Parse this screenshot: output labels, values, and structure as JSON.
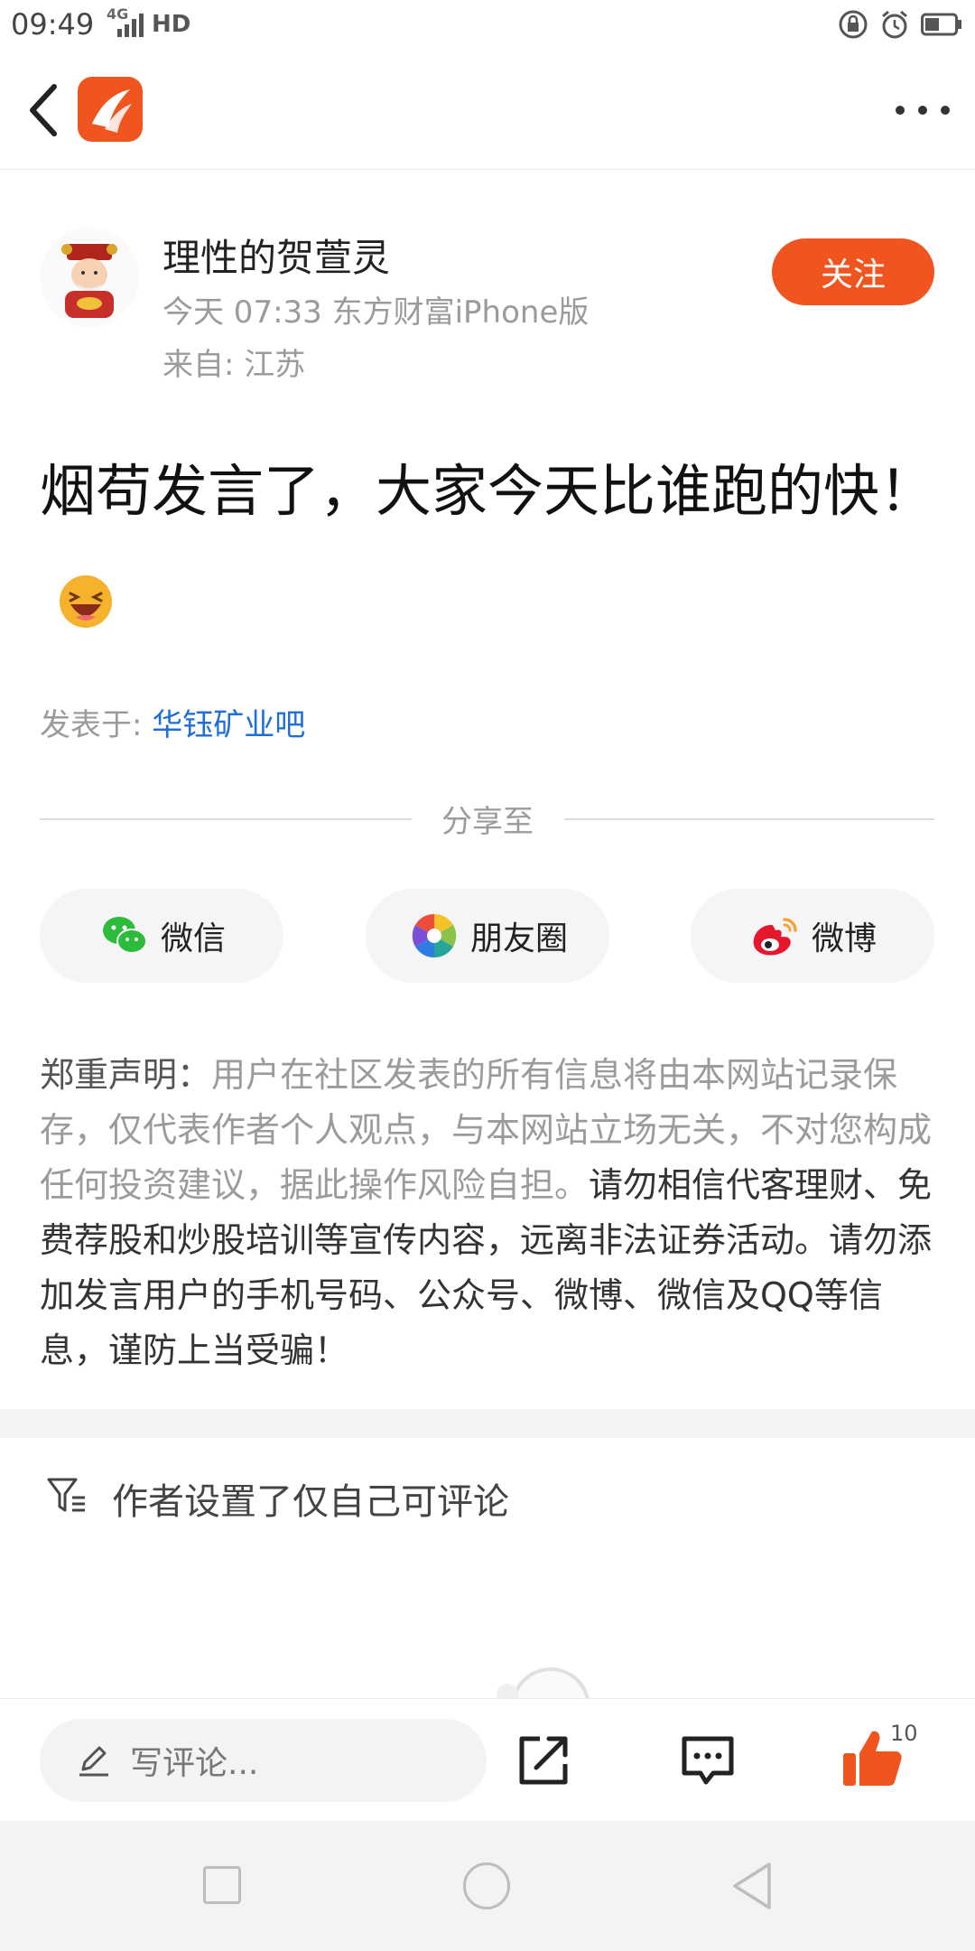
{
  "status_bar": {
    "time": "09:49",
    "network": "4G",
    "hd": "HD"
  },
  "header": {
    "icons": [
      "back-arrow-icon",
      "app-logo",
      "more-icon"
    ]
  },
  "author": {
    "name": "理性的贺萱灵",
    "meta": "今天 07:33 东方财富iPhone版",
    "location": "来自: 江苏",
    "follow_label": "关注"
  },
  "post": {
    "title": "烟苟发言了，大家今天比谁跑的快！",
    "posted_in_label": "发表于:",
    "board": "华钰矿业吧"
  },
  "share": {
    "label": "分享至",
    "targets": [
      {
        "label": "微信",
        "icon": "wechat-icon"
      },
      {
        "label": "朋友圈",
        "icon": "moments-icon"
      },
      {
        "label": "微博",
        "icon": "weibo-icon"
      }
    ]
  },
  "disclaimer": {
    "head": "郑重声明：",
    "body": "用户在社区发表的所有信息将由本网站记录保存，仅代表作者个人观点，与本网站立场无关，不对您构成任何投资建议，据此操作风险自担。",
    "warning": "请勿相信代客理财、免费荐股和炒股培训等宣传内容，远离非法证券活动。请勿添加发言用户的手机号码、公众号、微博、微信及QQ等信息，谨防上当受骗！"
  },
  "comments": {
    "restriction_note": "作者设置了仅自己可评论"
  },
  "bottom_bar": {
    "input_placeholder": "写评论...",
    "like_count": "10"
  },
  "colors": {
    "accent": "#f0551f",
    "link": "#1f6fd6",
    "muted": "#9b9b9b"
  }
}
